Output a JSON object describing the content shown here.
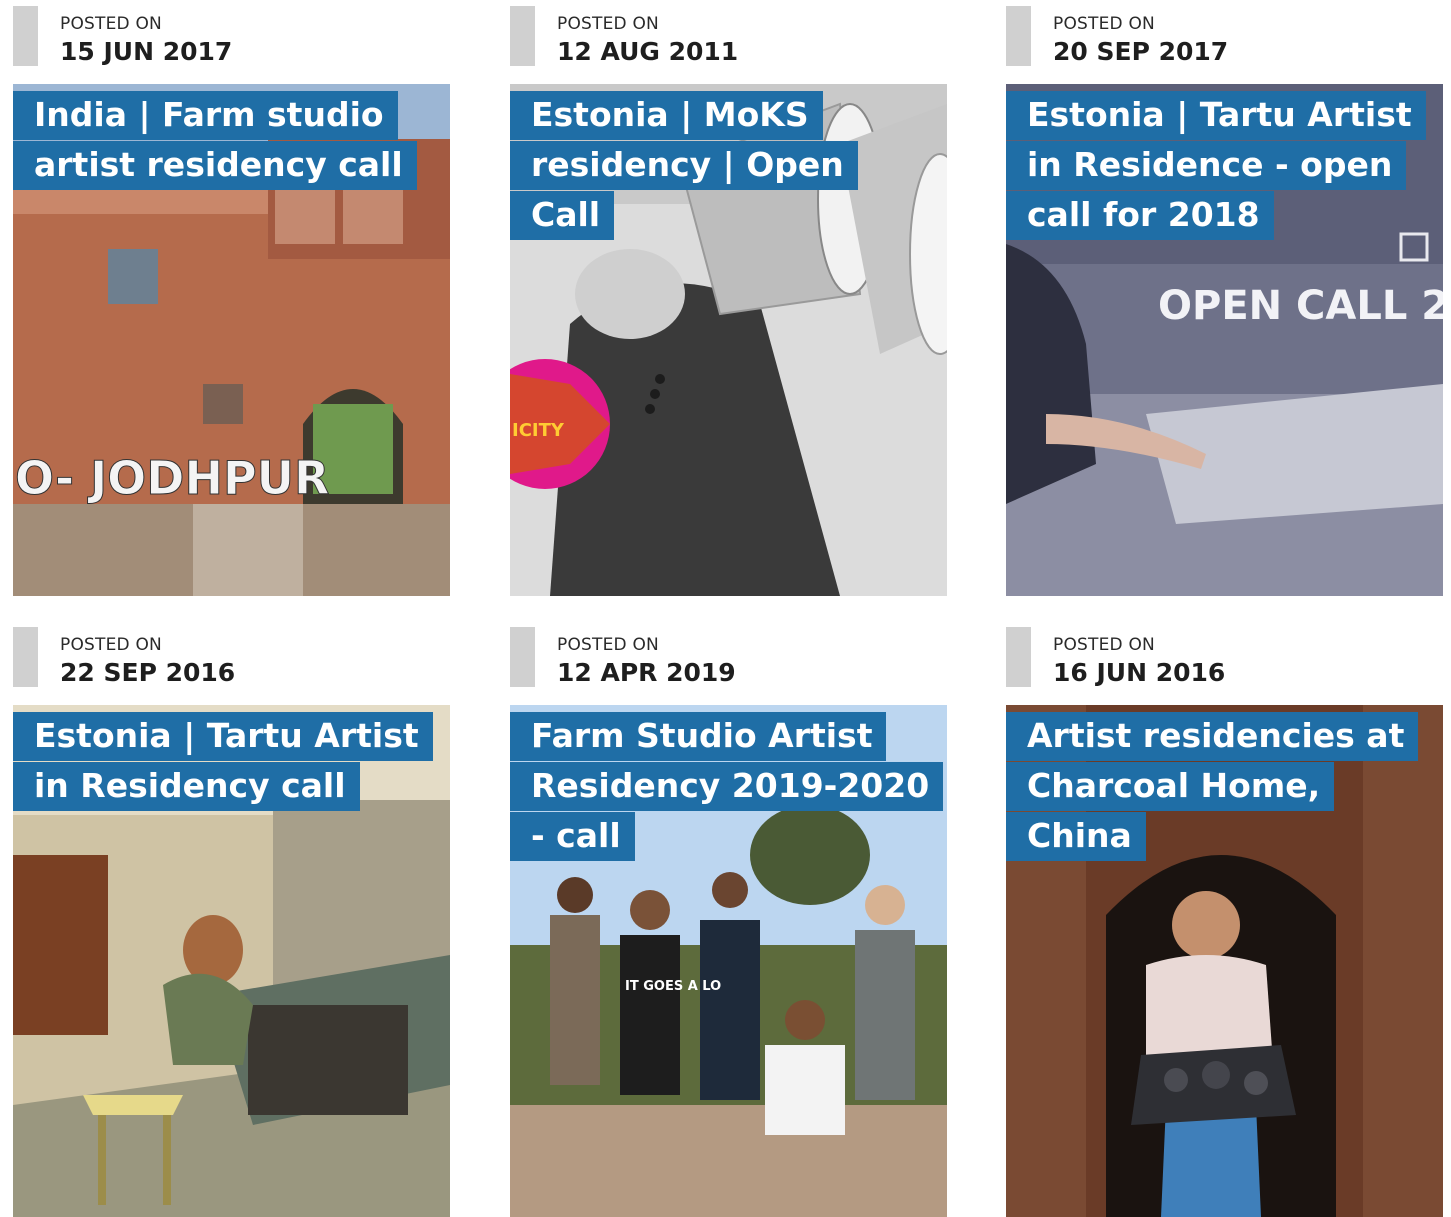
{
  "posts": [
    {
      "posted_label": "POSTED ON",
      "date": "15 JUN 2017",
      "title": "India | Farm studio artist residency call",
      "image_text": "O- JODHPUR"
    },
    {
      "posted_label": "POSTED ON",
      "date": "12 AUG 2011",
      "title": "Estonia | MoKS residency | Open Call",
      "image_text": "ICITY"
    },
    {
      "posted_label": "POSTED ON",
      "date": "20 SEP 2017",
      "title": "Estonia | Tartu Artist in Residence - open call for 2018",
      "image_text": "OPEN CALL 2"
    },
    {
      "posted_label": "POSTED ON",
      "date": "22 SEP 2016",
      "title": "Estonia | Tartu Artist in Residency call"
    },
    {
      "posted_label": "POSTED ON",
      "date": "12 APR 2019",
      "title": "Farm Studio Artist Residency 2019-2020 - call",
      "image_text": "IT GOES A LO"
    },
    {
      "posted_label": "POSTED ON",
      "date": "16 JUN 2016",
      "title": "Artist residencies at Charcoal Home, China"
    }
  ],
  "colors": {
    "title_bg": "#1f6ea6",
    "date_bar": "#d0d0d0"
  }
}
